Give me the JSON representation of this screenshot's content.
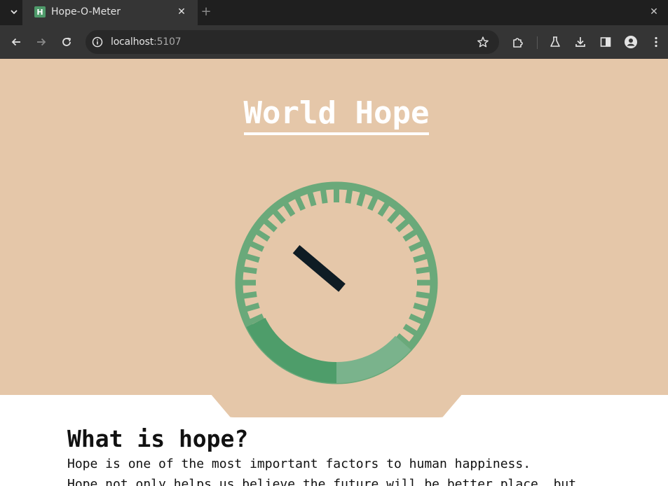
{
  "browser": {
    "tab": {
      "title": "Hope-O-Meter",
      "favicon_letter": "H"
    },
    "address": {
      "host": "localhost",
      "port": ":5107"
    },
    "colors": {
      "tabstrip": "#1f1f1f",
      "toolbar": "#353535",
      "omnibox": "#282828"
    }
  },
  "page": {
    "title": "World Hope",
    "gauge": {
      "level_fraction": 0.23,
      "needle_angle_deg": -50,
      "colors": {
        "accent": "#4e9d6a",
        "track": "#6aa97a",
        "needle": "#0f1c24",
        "background": "#e5c7a9"
      }
    },
    "section": {
      "heading": "What is hope?",
      "paragraphs": [
        "Hope is one of the most important factors to human happiness.",
        "Hope not only helps us believe the future will be better place, but"
      ]
    }
  }
}
